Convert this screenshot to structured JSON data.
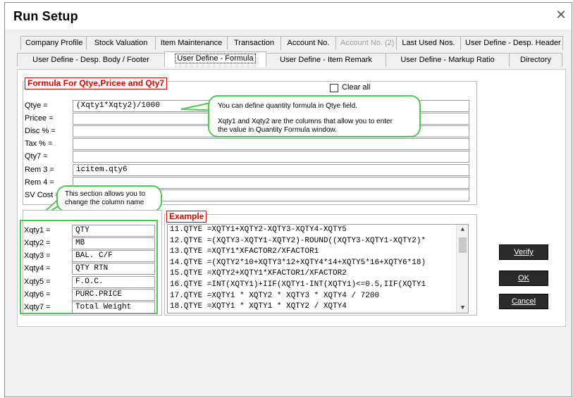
{
  "window": {
    "title": "Run Setup",
    "close_glyph": "✕"
  },
  "tabs_row1": [
    "Company Profile",
    "Stock Valuation",
    "Item Maintenance",
    "Transaction",
    "Account No.",
    "Account No. (2)",
    "Last Used Nos.",
    "User Define - Desp. Header"
  ],
  "tabs_row2": [
    "User Define - Desp. Body / Footer",
    "User Define - Formula",
    "User Define - Item Remark",
    "User Define - Markup Ratio",
    "Directory"
  ],
  "formula": {
    "legend": "Formula For Qtye,Pricee and Qty7",
    "clear_all": "Clear all",
    "rows": [
      {
        "label": "Qtye =",
        "value": "(Xqty1*Xqty2)/1000"
      },
      {
        "label": "Pricee =",
        "value": ""
      },
      {
        "label": "Disc % =",
        "value": ""
      },
      {
        "label": "Tax % =",
        "value": ""
      },
      {
        "label": "Qty7 =",
        "value": ""
      },
      {
        "label": "Rem 3 =",
        "value": "icitem.qty6"
      },
      {
        "label": "Rem 4 =",
        "value": ""
      },
      {
        "label": "SV Cost =",
        "value": ""
      }
    ]
  },
  "callouts": {
    "qtye_line1": "You can define quantity formula in Qtye field.",
    "qtye_line2": "Xqty1 and Xqty2 are the columns that allow you to enter",
    "qtye_line3": "the value in Quantity Formula window.",
    "section_line1": "This section allows you to",
    "section_line2": "change the column name"
  },
  "xqty": [
    {
      "label": "Xqty1 =",
      "value": "QTY"
    },
    {
      "label": "Xqty2 =",
      "value": "MB"
    },
    {
      "label": "Xqty3 =",
      "value": "BAL. C/F"
    },
    {
      "label": "Xqty4 =",
      "value": "QTY RTN"
    },
    {
      "label": "Xqty5 =",
      "value": "F.O.C."
    },
    {
      "label": "Xqty6 =",
      "value": "PURC.PRICE"
    },
    {
      "label": "Xqty7 =",
      "value": "Total Weight"
    }
  ],
  "example": {
    "legend": "Example",
    "lines": [
      "11.QTYE   =XQTY1+XQTY2-XQTY3-XQTY4-XQTY5",
      "12.QTYE   =(XQTY3-XQTY1-XQTY2)-ROUND((XQTY3-XQTY1-XQTY2)*",
      "13.QTYE   =XQTY1*XFACTOR2/XFACTOR1",
      "14.QTYE   =(XQTY2*10+XQTY3*12+XQTY4*14+XQTY5*16+XQTY6*18)",
      "15.QTYE   =XQTY2+XQTY1*XFACTOR1/XFACTOR2",
      "16.QTYE   =INT(XQTY1)+IIF(XQTY1-INT(XQTY1)<=0.5,IIF(XQTY1",
      "17.QTYE   =XQTY1 * XQTY2 * XQTY3 * XQTY4 / 7200",
      "18.QTYE   =XQTY1 * XQTY1 * XQTY2 / XQTY4"
    ]
  },
  "buttons": {
    "verify": "Verify",
    "ok": "OK",
    "cancel": "Cancel"
  },
  "colors": {
    "accent_green": "#4fc84f",
    "legend_red": "#e00000",
    "button_dark": "#2b2b2b"
  }
}
